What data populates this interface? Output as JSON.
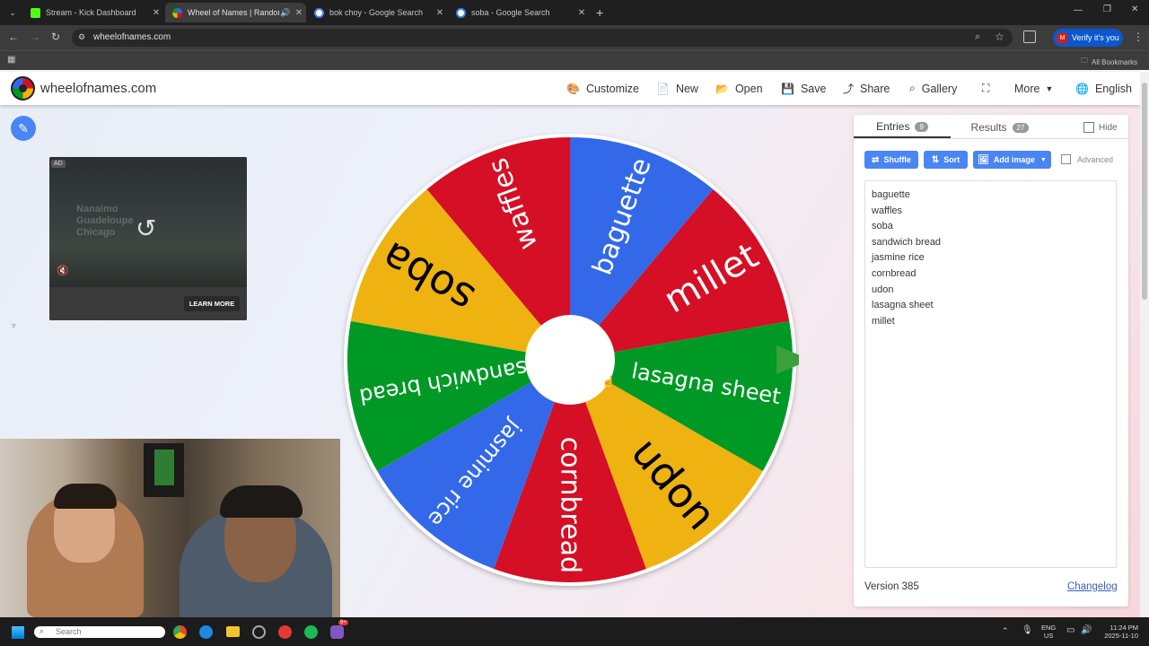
{
  "browser": {
    "tabs": [
      {
        "title": "Stream - Kick Dashboard",
        "favicon_color": "#53fc18",
        "active": false
      },
      {
        "title": "Wheel of Names | Random",
        "favicon_color": "#4285f4",
        "active": true
      },
      {
        "title": "bok choy - Google Search",
        "favicon_color": "#ffffff",
        "active": false
      },
      {
        "title": "soba - Google Search",
        "favicon_color": "#ffffff",
        "active": false
      }
    ],
    "url": "wheelofnames.com",
    "verify_label": "Verify it's you",
    "all_bookmarks": "All Bookmarks"
  },
  "site": {
    "logo_text": "wheelofnames.com",
    "nav": {
      "customize": "Customize",
      "new": "New",
      "open": "Open",
      "save": "Save",
      "share": "Share",
      "gallery": "Gallery",
      "more": "More",
      "language": "English"
    }
  },
  "ad": {
    "badge": "AD",
    "learn_more": "LEARN MORE",
    "overlay_lines": [
      "Nanaimo",
      "Guadeloupe",
      "Chicago"
    ]
  },
  "wheel": {
    "segments": [
      {
        "label": "baguette",
        "color": "#3369e8"
      },
      {
        "label": "millet",
        "color": "#d50f25"
      },
      {
        "label": "lasagna sheet",
        "color": "#009925"
      },
      {
        "label": "udon",
        "color": "#eeb211"
      },
      {
        "label": "cornbread",
        "color": "#d50f25"
      },
      {
        "label": "jasmine rice",
        "color": "#3369e8"
      },
      {
        "label": "sandwich bread",
        "color": "#009925"
      },
      {
        "label": "soba",
        "color": "#eeb211"
      },
      {
        "label": "waffles",
        "color": "#d50f25"
      }
    ]
  },
  "panel": {
    "entries_tab": "Entries",
    "entries_count": "9",
    "results_tab": "Results",
    "results_count": "27",
    "hide_label": "Hide",
    "shuffle": "Shuffle",
    "sort": "Sort",
    "add_image": "Add image",
    "advanced": "Advanced",
    "entries": [
      "baguette",
      "waffles",
      "soba",
      "sandwich bread",
      "jasmine rice",
      "cornbread",
      "udon",
      "lasagna sheet",
      "millet"
    ],
    "version": "Version 385",
    "changelog": "Changelog"
  },
  "taskbar": {
    "search_placeholder": "Search",
    "lang_top": "ENG",
    "lang_bottom": "US",
    "time": "11:24 PM",
    "date": "2025-11-10",
    "notification_badge": "9+"
  }
}
